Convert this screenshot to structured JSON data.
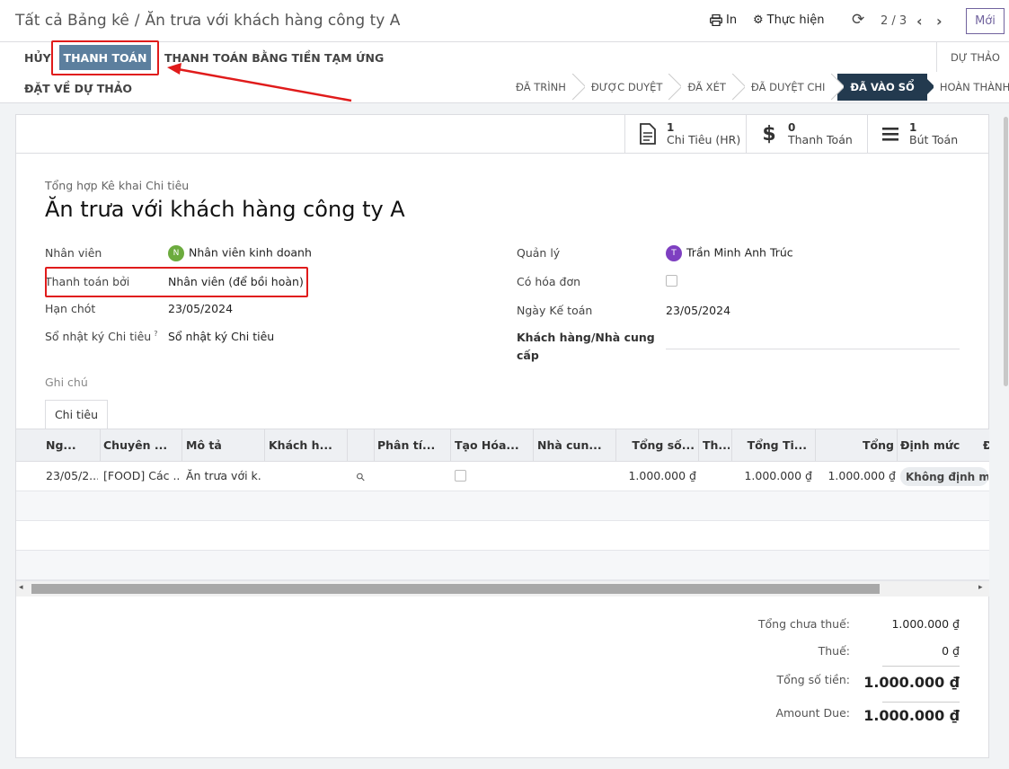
{
  "breadcrumb": {
    "parent": "Tất cả Bảng kê",
    "separator": "/",
    "current": "Ăn trưa với khách hàng công ty A"
  },
  "toolbar": {
    "print_label": "In",
    "action_label": "Thực hiện",
    "pager": "2 / 3",
    "new_label": "Mới"
  },
  "buttons": {
    "cancel": "HỦY",
    "pay": "THANH TOÁN",
    "pay_advance": "THANH TOÁN BẰNG TIỀN TẠM ỨNG",
    "reset_draft": "ĐẶT VỀ DỰ THẢO"
  },
  "status_draft": "DỰ THẢO",
  "stages": [
    "ĐÃ TRÌNH",
    "ĐƯỢC DUYỆT",
    "ĐÃ XÉT",
    "ĐÃ DUYỆT CHI",
    "ĐÃ VÀO SỔ",
    "HOÀN THÀNH"
  ],
  "active_stage": "ĐÃ VÀO SỔ",
  "smart_buttons": [
    {
      "count": "1",
      "label": "Chi Tiêu (HR)",
      "icon": "document-icon"
    },
    {
      "count": "0",
      "label": "Thanh Toán",
      "icon": "dollar-icon"
    },
    {
      "count": "1",
      "label": "Bút Toán",
      "icon": "list-icon"
    }
  ],
  "form": {
    "subtitle": "Tổng hợp Kê khai Chi tiêu",
    "title": "Ăn trưa với khách hàng công ty A",
    "employee_label": "Nhân viên",
    "employee_initial": "N",
    "employee": "Nhân viên kinh doanh",
    "paid_by_label": "Thanh toán bởi",
    "paid_by": "Nhân viên (để bồi hoàn)",
    "deadline_label": "Hạn chót",
    "deadline": "23/05/2024",
    "journal_label": "Sổ nhật ký Chi tiêu",
    "journal_help": "?",
    "journal": "Sổ nhật ký Chi tiêu",
    "manager_label": "Quản lý",
    "manager_initial": "T",
    "manager": "Trần Minh Anh Trúc",
    "has_invoice_label": "Có hóa đơn",
    "accounting_date_label": "Ngày Kế toán",
    "accounting_date": "23/05/2024",
    "partner_label_1": "Khách hàng/Nhà cung",
    "partner_label_2": "cấp",
    "notes_label": "Ghi chú"
  },
  "tab_label": "Chi tiêu",
  "table": {
    "headers": [
      "Ng...",
      "Chuyên ...",
      "Mô tả",
      "Khách h...",
      "Phân tí...",
      "Tạo Hóa...",
      "Nhà cun...",
      "Tổng số...",
      "Th...",
      "Tổng Ti...",
      "Tổng",
      "Định mức",
      "Đ"
    ],
    "rows": [
      {
        "date": "23/05/2...",
        "category": "[FOOD] Các ...",
        "description": "Ăn trưa với k...",
        "amount": "1.000.000 ₫",
        "total_tax": "1.000.000 ₫",
        "total": "1.000.000 ₫",
        "limit": "Không định mức"
      }
    ]
  },
  "totals": {
    "untaxed_label": "Tổng chưa thuế:",
    "untaxed": "1.000.000 ₫",
    "tax_label": "Thuế:",
    "tax": "0 ₫",
    "total_label": "Tổng số tiền:",
    "total": "1.000.000 ₫",
    "due_label": "Amount Due:",
    "due": "1.000.000 ₫"
  },
  "colors": {
    "active_stage": "#233a4f",
    "pay_button": "#5c7f9e",
    "annotation": "#e01b1b",
    "brand": "#71639e"
  }
}
